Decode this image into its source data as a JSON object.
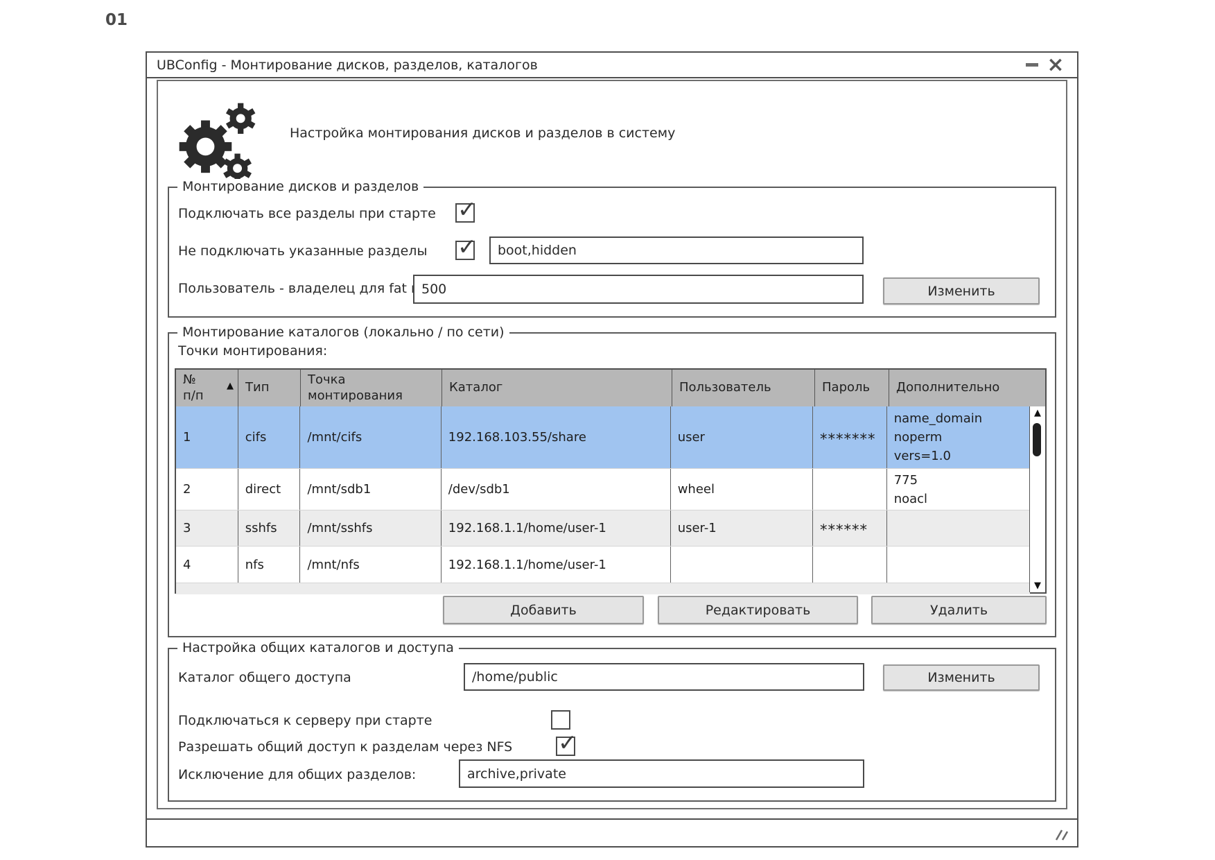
{
  "page": {
    "label": "01"
  },
  "window": {
    "title": "UBConfig - Монтирование дисков, разделов, каталогов",
    "subtitle": "Настройка монтирования дисков и разделов в систему",
    "controls": {
      "close": "×"
    }
  },
  "group_disks": {
    "legend": "Монтирование дисков и разделов",
    "mount_all": {
      "label": "Подключать все разделы при старте",
      "checked": true
    },
    "exclude": {
      "label": "Не подключать указанные разделы",
      "checked": true,
      "value": "boot,hidden"
    },
    "owner": {
      "label": "Пользователь - владелец для fat ntfs",
      "value": "500"
    },
    "change_button": "Изменить"
  },
  "group_mounts": {
    "legend": "Монтирование каталогов (локально / по сети)",
    "points_label": "Точки монтирования:",
    "table": {
      "sort_icon": "▲",
      "columns": {
        "num": "№\nп/п",
        "type": "Тип",
        "point": "Точка\nмонтирования",
        "catalog": "Каталог",
        "user": "Пользователь",
        "password": "Пароль",
        "extra": "Дополнительно"
      },
      "rows": [
        {
          "num": "1",
          "type": "cifs",
          "point": "/mnt/cifs",
          "catalog": "192.168.103.55/share",
          "user": "user",
          "password": "*******",
          "extra": "name_domain\nnoperm\nvers=1.0",
          "selected": true
        },
        {
          "num": "2",
          "type": "direct",
          "point": "/mnt/sdb1",
          "catalog": "/dev/sdb1",
          "user": "wheel",
          "password": "",
          "extra": "775\nnoacl",
          "selected": false
        },
        {
          "num": "3",
          "type": "sshfs",
          "point": "/mnt/sshfs",
          "catalog": "192.168.1.1/home/user-1",
          "user": "user-1",
          "password": "******",
          "extra": "",
          "selected": false
        },
        {
          "num": "4",
          "type": "nfs",
          "point": "/mnt/nfs",
          "catalog": "192.168.1.1/home/user-1",
          "user": "",
          "password": "",
          "extra": "",
          "selected": false
        }
      ],
      "scrollbar": {
        "up": "▲",
        "down": "▼"
      }
    },
    "buttons": {
      "add": "Добавить",
      "edit": "Редактировать",
      "delete": "Удалить"
    }
  },
  "group_share": {
    "legend": "Настройка общих каталогов и доступа",
    "share_dir": {
      "label": "Каталог общего доступа",
      "value": "/home/public"
    },
    "change_button": "Изменить",
    "connect_on_start": {
      "label": "Подключаться к серверу при старте",
      "checked": false
    },
    "allow_nfs": {
      "label": "Разрешать общий доступ к разделам через NFS",
      "checked": true
    },
    "exclusions": {
      "label": "Исключение для общих разделов:",
      "value": "archive,private"
    }
  },
  "colors": {
    "selected_row": "#a0c4f0",
    "table_header": "#b7b7b7",
    "alt_row": "#ececec",
    "button_bg": "#e4e4e4",
    "stroke": "#4f4f4f"
  }
}
